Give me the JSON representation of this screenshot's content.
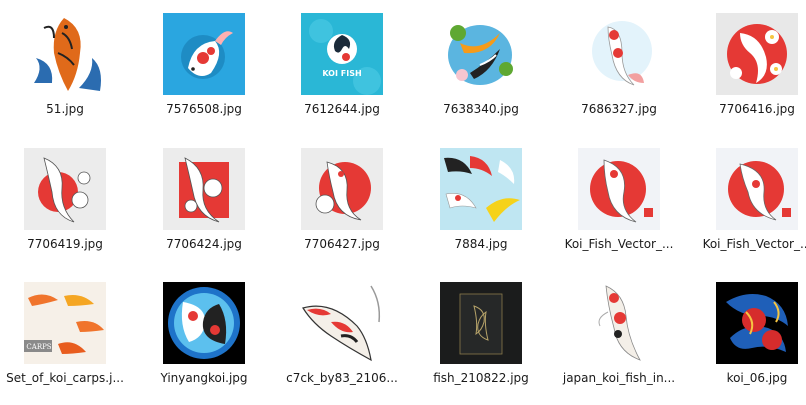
{
  "files": [
    {
      "name": "51.jpg",
      "icon": "koi-illustration-thumbnail"
    },
    {
      "name": "7576508.jpg",
      "icon": "koi-illustration-thumbnail"
    },
    {
      "name": "7612644.jpg",
      "icon": "koi-logo-thumbnail",
      "overlay_text": "KOI FISH"
    },
    {
      "name": "7638340.jpg",
      "icon": "koi-pond-thumbnail"
    },
    {
      "name": "7686327.jpg",
      "icon": "koi-illustration-thumbnail"
    },
    {
      "name": "7706416.jpg",
      "icon": "koi-pattern-thumbnail"
    },
    {
      "name": "7706419.jpg",
      "icon": "koi-sketch-thumbnail"
    },
    {
      "name": "7706424.jpg",
      "icon": "koi-sketch-thumbnail"
    },
    {
      "name": "7706427.jpg",
      "icon": "koi-sun-thumbnail"
    },
    {
      "name": "7884.jpg",
      "icon": "koi-pattern-thumbnail"
    },
    {
      "name": "Koi_Fish_Vector_...",
      "icon": "koi-sun-thumbnail"
    },
    {
      "name": "Koi_Fish_Vector_...",
      "icon": "koi-sun-thumbnail"
    },
    {
      "name": "Set_of_koi_carps.j...",
      "icon": "koi-set-thumbnail",
      "overlay_text": "CARPS"
    },
    {
      "name": "Yinyangkoi.jpg",
      "icon": "koi-yinyang-thumbnail"
    },
    {
      "name": "c7ck_by83_2106...",
      "icon": "koi-sticker-thumbnail"
    },
    {
      "name": "fish_210822.jpg",
      "icon": "koi-card-thumbnail"
    },
    {
      "name": "japan_koi_fish_in...",
      "icon": "koi-illustration-thumbnail"
    },
    {
      "name": "koi_06.jpg",
      "icon": "koi-tattoo-thumbnail"
    }
  ]
}
